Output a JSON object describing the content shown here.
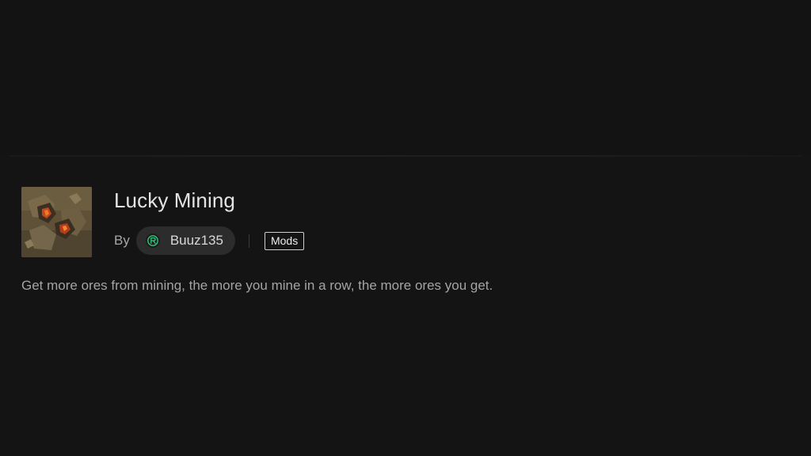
{
  "mod": {
    "title": "Lucky Mining",
    "by_label": "By",
    "author": "Buuz135",
    "category": "Mods",
    "description": "Get more ores from mining, the more you mine in a row, the more ores you get.",
    "thumbnail_icon": "ore-block-thumbnail",
    "author_avatar_icon": "author-avatar-icon"
  },
  "colors": {
    "background": "#141414",
    "title_text": "#e4e4e4",
    "muted_text": "#a4a4a4",
    "chip_background": "#2c2c2c",
    "avatar_accent": "#2fc77a"
  }
}
